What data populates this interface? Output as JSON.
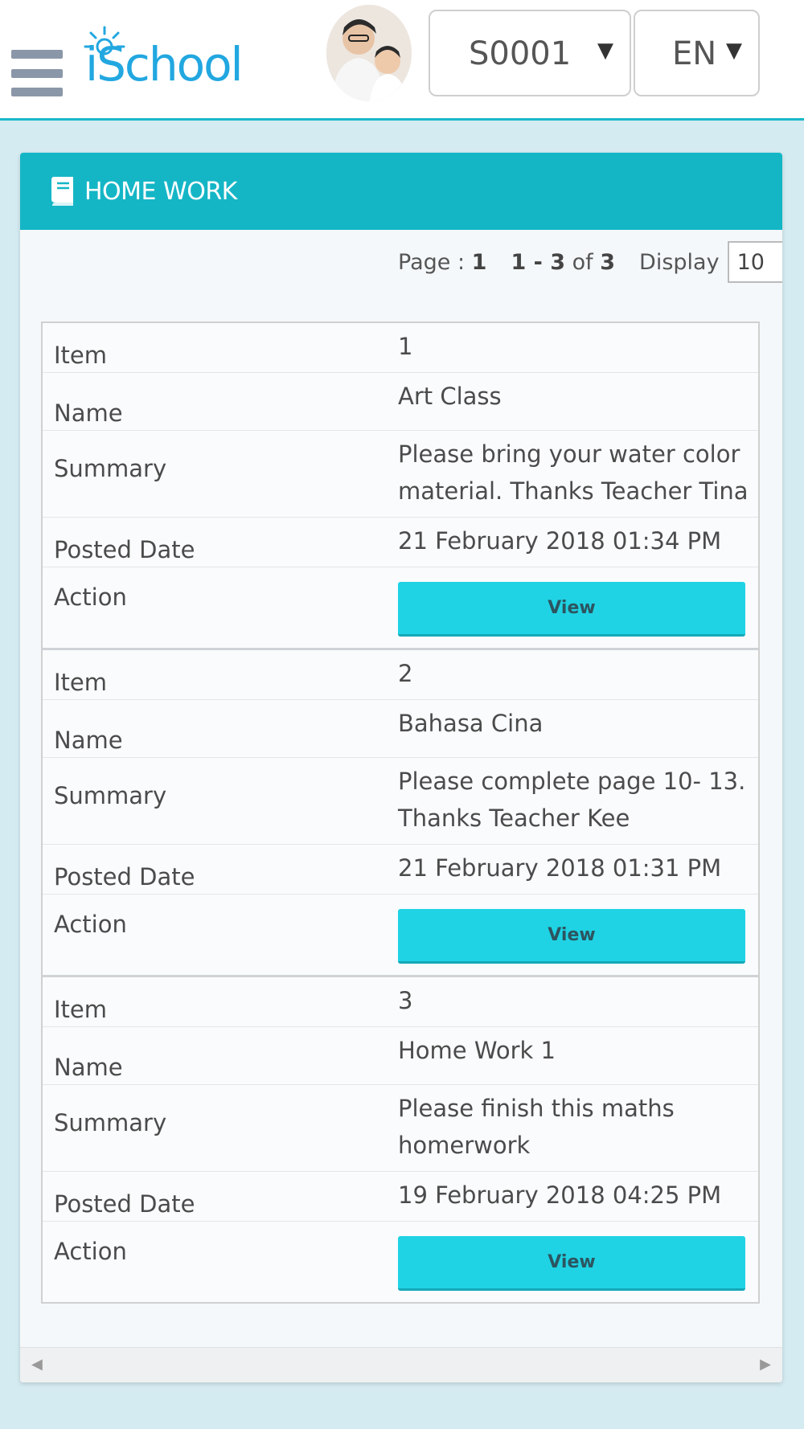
{
  "header": {
    "logo_text": "iSchool",
    "student_select": "S0001",
    "language_select": "EN"
  },
  "panel": {
    "title": "HOME WORK",
    "pager": {
      "page_label": "Page :",
      "page_number": "1",
      "range": "1 - 3",
      "of_label": "of",
      "total": "3",
      "display_label": "Display",
      "display_value": "10"
    }
  },
  "labels": {
    "item": "Item",
    "name": "Name",
    "summary": "Summary",
    "posted_date": "Posted Date",
    "action": "Action",
    "view_button": "View"
  },
  "records": [
    {
      "item": "1",
      "name": "Art Class",
      "summary": "Please bring your water color material. Thanks Teacher Tina",
      "posted_date": "21 February 2018 01:34 PM"
    },
    {
      "item": "2",
      "name": "Bahasa Cina",
      "summary": "Please complete page 10- 13. Thanks Teacher Kee",
      "posted_date": "21 February 2018 01:31 PM"
    },
    {
      "item": "3",
      "name": "Home Work 1",
      "summary": "Please finish this maths homerwork",
      "posted_date": "19 February 2018 04:25 PM"
    }
  ],
  "colors": {
    "accent": "#14b6c6",
    "button": "#1fd3e4",
    "logo": "#22a7e0"
  }
}
